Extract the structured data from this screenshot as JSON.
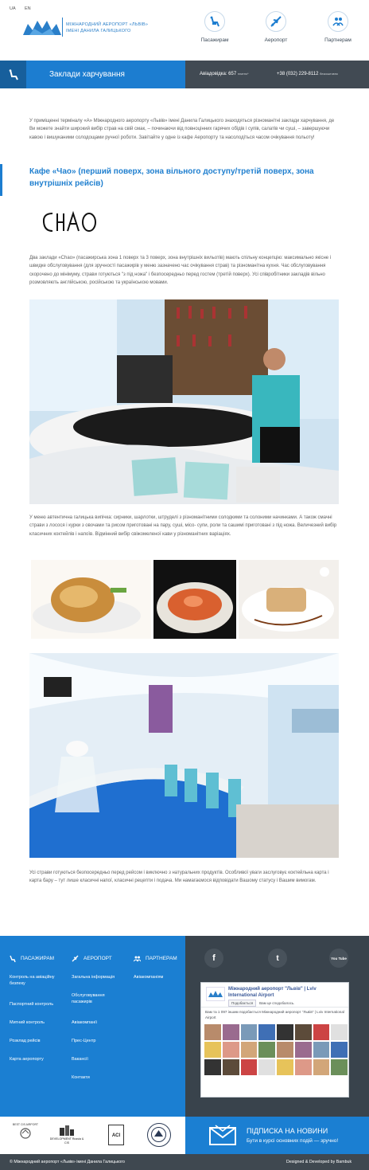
{
  "header": {
    "lang": [
      "UA",
      "EN"
    ],
    "logo_line1": "МІЖНАРОДНИЙ АЕРОПОРТ «ЛЬВІВ»",
    "logo_line2": "ІМЕНІ ДАНИЛА ГАЛИЦЬКОГО",
    "nav": [
      {
        "label": "Пасажирам",
        "icon": "passenger-icon"
      },
      {
        "label": "Аеропорт",
        "icon": "plane-icon"
      },
      {
        "label": "Партнерам",
        "icon": "partners-icon"
      }
    ]
  },
  "title_bar": {
    "title": "Заклади харчування",
    "icon": "seat-icon",
    "info_label": "Авіадовідка: 657",
    "info_label_small": "платно*",
    "phone": "+38 (032) 229-8112",
    "phone_small": "безкоштовно"
  },
  "content": {
    "intro": "У приміщенні терміналу «А» Міжнародного аеропорту «Львів» імені Данила Галицького знаходяться різноманітні заклади харчування, де Ви можете знайти широкий вибір страв на свій смак, – починаючи від повноцінних гарячих обідів і супів, салатів чи суші, – завершуючи кавою і вишуканими солодощами ручної роботи. Завітайте у одне із кафе Аеропорту та насолодіться часом очікування польоту!",
    "section_title": "Кафе «Чао» (перший поверх, зона вільного доступу/третій поверх, зона внутрішніх рейсів)",
    "cafe_logo": "Chao",
    "para1": "Два заклади «Chao» (пасажирська зона 1 поверх та 3 поверх, зона внутрішніх вильотів) мають спільну концепцію: максимально якісне і швидке обслуговування (для зручності пасажирів у меню зазначено час очікування страв) та різноманітна кухня. Час обслуговування скорочено до мінімуму, страви готуються \"з під ножа\" і безпосередньо перед гостем (третій поверх). Усі співробітники закладів вільно розмовляють англійською, російською та українською мовами.",
    "para2": "У меню автентична галицька випічка: сирники, шарлотки, штруделі з різноманітними солодкими та солоними начинками. А також смачні страви з лосося і курки з овочами та рисом приготовані на пару, суші, місо- супи, роли та сашимі приготовані з під ножа. Величезний вибір класичних коктейлів і напоїв. Відмінний вибір свіжомеленої кави у різноманітних варіаціях.",
    "para3": "Усі страви готуються безпосередньо перед рейсом і виключно з натуральних продуктів. Особливої уваги заслуговує коктейльна карта і карта бару – тут лише класичні напої, класичні рецепти і подача. Ми намагаємося відповідати Вашому статусу і Вашим вимогам."
  },
  "footer": {
    "columns": [
      {
        "head": "ПАСАЖИРАМ",
        "icon": "passenger-icon",
        "links": [
          "Контроль на авіаційну безпеку",
          "Паспортний контроль",
          "Митний контроль",
          "Розклад рейсів",
          "Карта аеропорту"
        ]
      },
      {
        "head": "АЕРОПОРТ",
        "icon": "plane-icon",
        "links": [
          "Загальна інформація",
          "Обслуговування пасажирів",
          "Авіакомпанії",
          "Прес-Центр",
          "Вакансії",
          "Контакти"
        ]
      },
      {
        "head": "ПАРТНЕРАМ",
        "icon": "partners-icon",
        "links": [
          "Авіакомпаніям"
        ]
      }
    ],
    "social": [
      {
        "label": "f",
        "icon": "facebook-icon"
      },
      {
        "label": "t",
        "icon": "twitter-icon"
      },
      {
        "label": "You Tube",
        "icon": "youtube-icon"
      }
    ],
    "fb": {
      "page_name": "Міжнародний аеропорт \"Львів\" | Lviv International Airport",
      "like_btn": "Подобається",
      "like_text": "Вам це сподобалось.",
      "count_text": "Вам та 1 097 іншим подобається Міжнародний аеропорт \"Львів\" | Lviv International Airport"
    },
    "subscribe_title": "ПІДПИСКА НА НОВИНИ",
    "subscribe_sub": "Бути в курсі основних подій — зручно!",
    "partner_logos": [
      "BEST CIS AIRPORT",
      "DEVELOPMENT Russia & CIS",
      "ACI",
      "seal"
    ],
    "copyright": "© Міжнародний аеропорт «Львів» імені Данила Галицького",
    "developer": "Designed & Developed by Bambuk"
  },
  "colors": {
    "primary": "#1c7dd0",
    "dark": "#414a53",
    "footer_dark": "#39434c"
  }
}
